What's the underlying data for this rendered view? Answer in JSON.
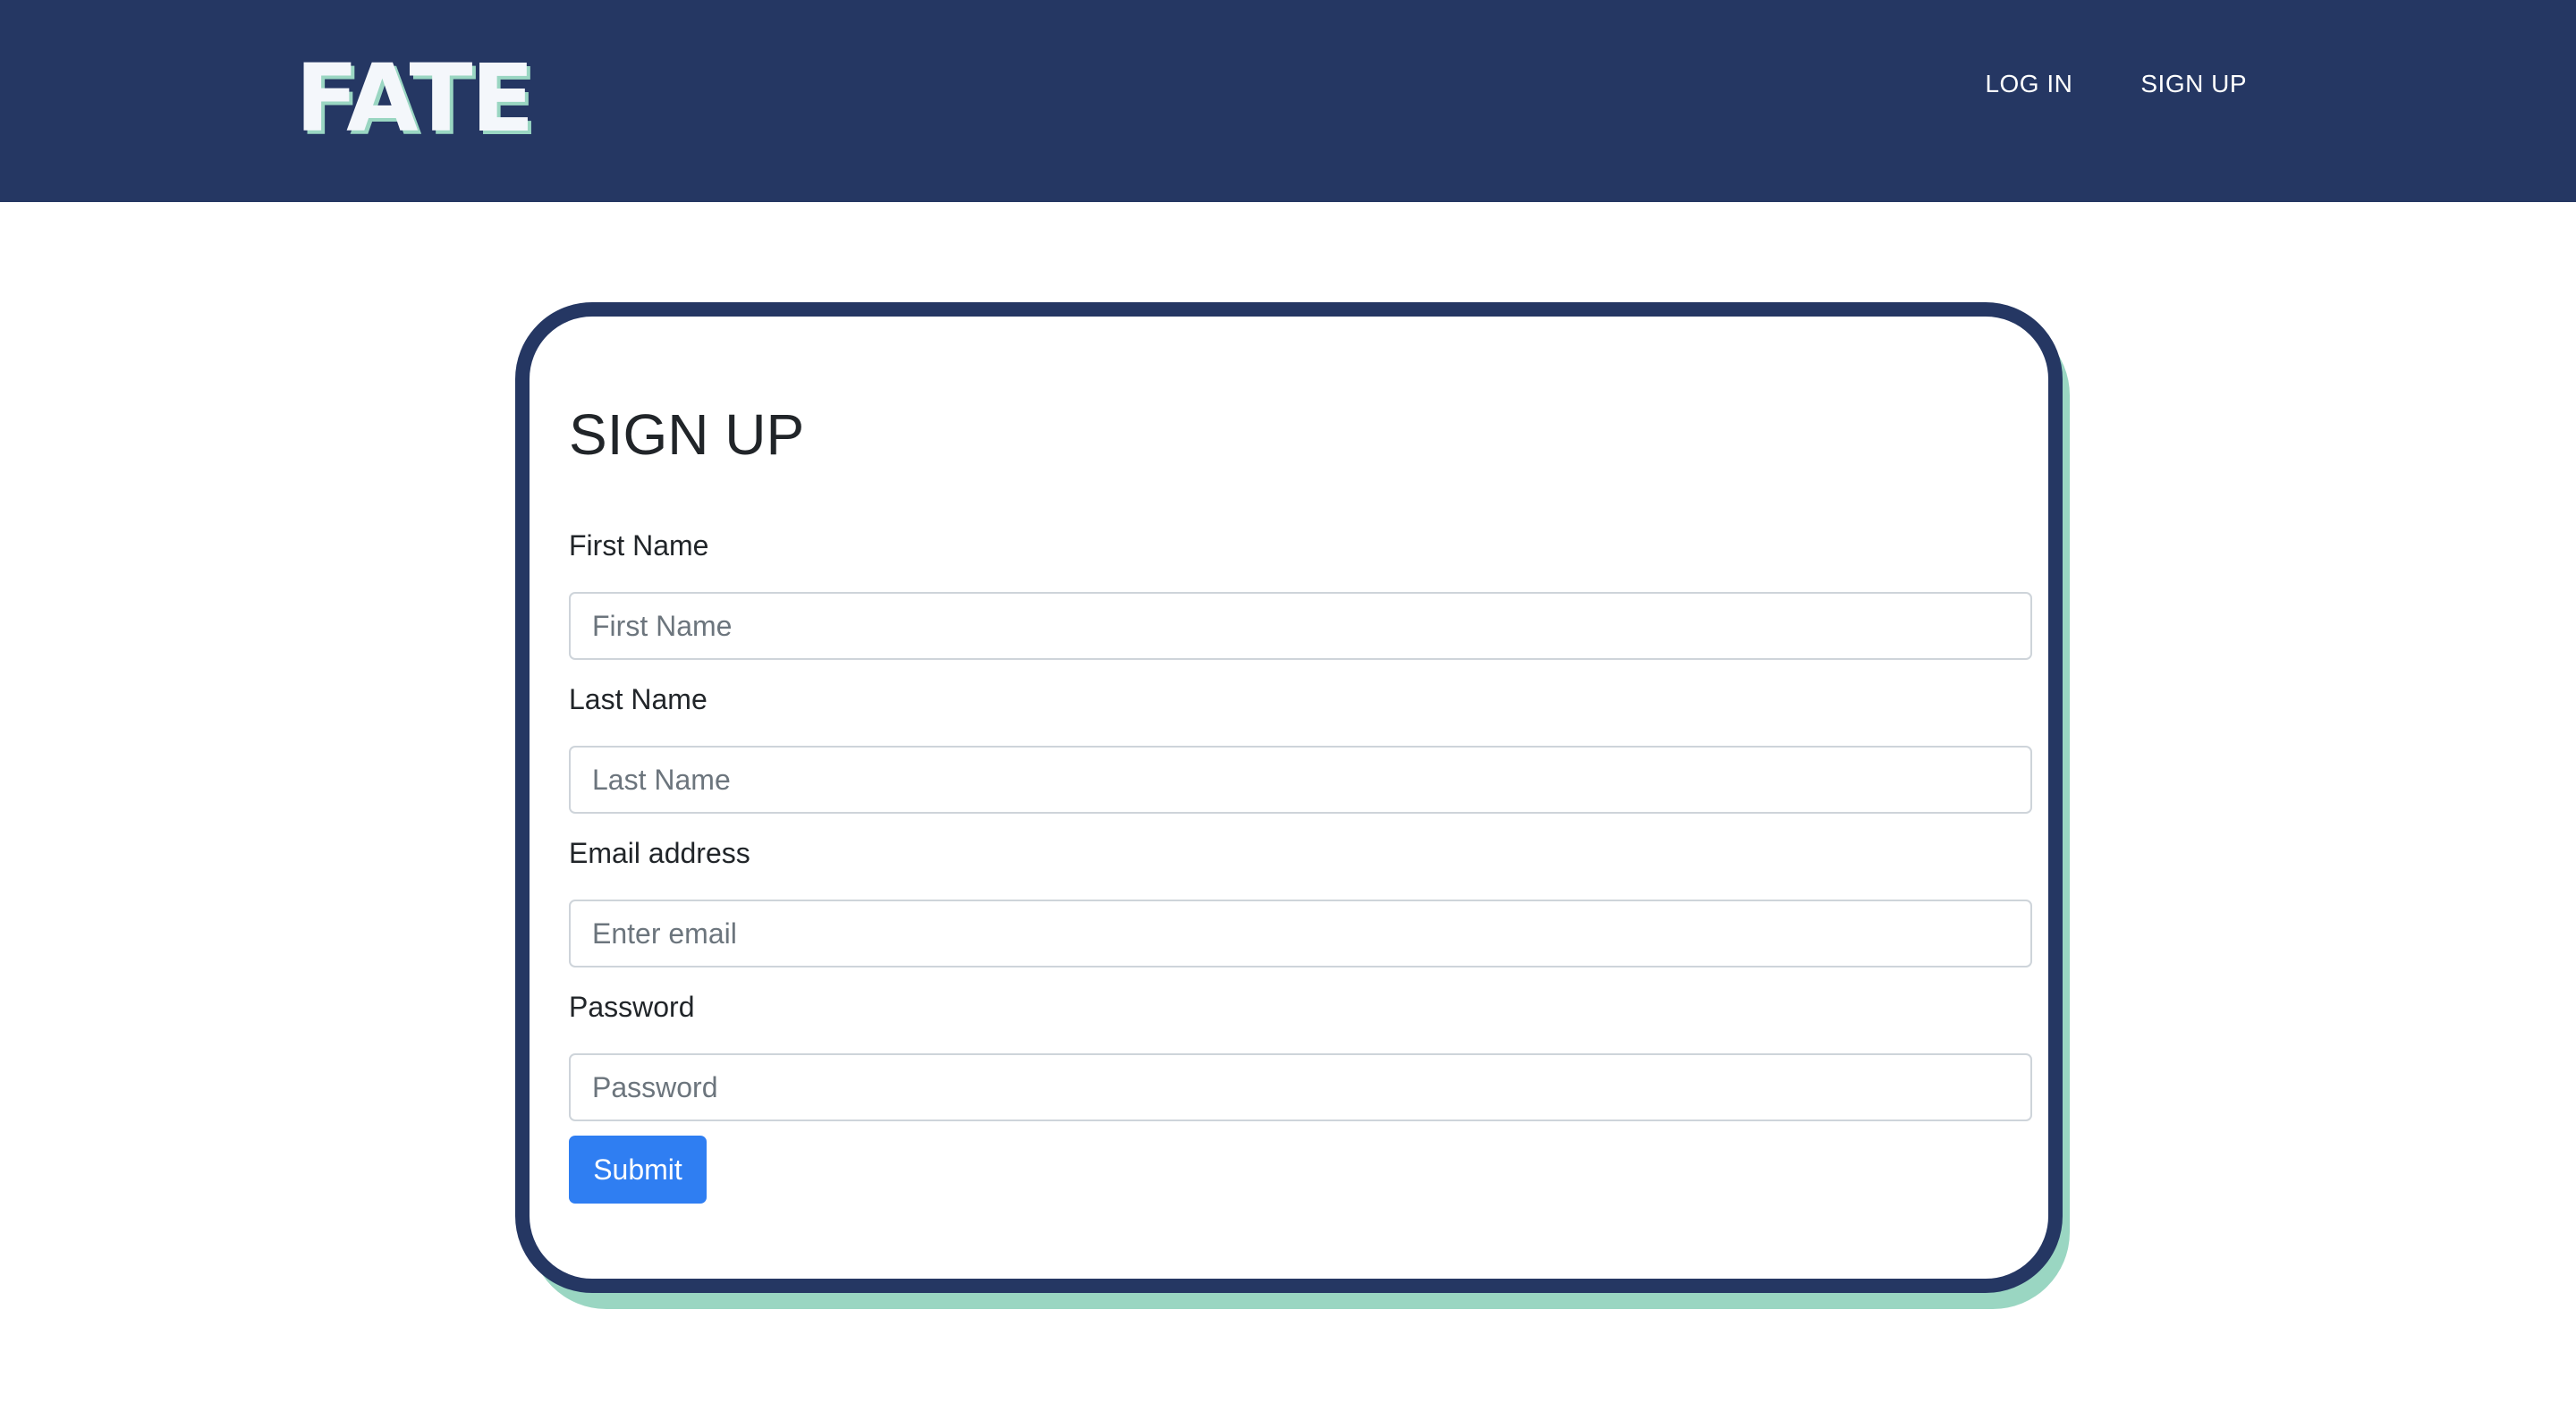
{
  "navbar": {
    "logo": "FATE",
    "links": [
      {
        "label": "LOG IN"
      },
      {
        "label": "SIGN UP"
      }
    ]
  },
  "colors": {
    "navbar_bg": "#253763",
    "accent": "#9ad6c2",
    "button": "#2f7ef2"
  },
  "form": {
    "title": "SIGN UP",
    "fields": [
      {
        "label": "First Name",
        "placeholder": "First Name",
        "value": ""
      },
      {
        "label": "Last Name",
        "placeholder": "Last Name",
        "value": ""
      },
      {
        "label": "Email address",
        "placeholder": "Enter email",
        "value": ""
      },
      {
        "label": "Password",
        "placeholder": "Password",
        "value": ""
      }
    ],
    "submit_label": "Submit"
  }
}
